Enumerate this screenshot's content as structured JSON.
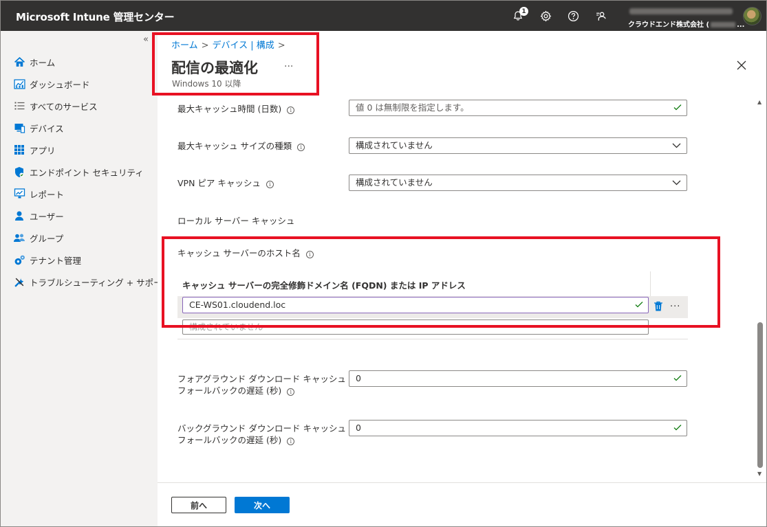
{
  "app": {
    "title": "Microsoft Intune 管理センター"
  },
  "topbar": {
    "notification_count": "1",
    "account_org": "クラウドエンド株式会社 (",
    "account_org_suffix": "..."
  },
  "sidebar": {
    "collapse_glyph": "«",
    "items": [
      {
        "label": "ホーム",
        "icon": "home-icon"
      },
      {
        "label": "ダッシュボード",
        "icon": "dashboard-icon"
      },
      {
        "label": "すべてのサービス",
        "icon": "list-icon"
      },
      {
        "label": "デバイス",
        "icon": "device-icon"
      },
      {
        "label": "アプリ",
        "icon": "apps-grid-icon"
      },
      {
        "label": "エンドポイント セキュリティ",
        "icon": "shield-icon"
      },
      {
        "label": "レポート",
        "icon": "report-icon"
      },
      {
        "label": "ユーザー",
        "icon": "user-icon"
      },
      {
        "label": "グループ",
        "icon": "group-icon"
      },
      {
        "label": "テナント管理",
        "icon": "tenant-gear-icon"
      },
      {
        "label": "トラブルシューティング + サポート",
        "icon": "tools-icon"
      }
    ]
  },
  "header": {
    "breadcrumb": [
      "ホーム",
      "デバイス | 構成"
    ],
    "breadcrumb_sep": ">",
    "title": "配信の最適化",
    "title_more": "...",
    "subtitle": "Windows 10 以降"
  },
  "settings": {
    "max_cache_age": {
      "label": "最大キャッシュ時間 (日数)",
      "value": "値 0 は無制限を指定します。"
    },
    "max_cache_size_type": {
      "label": "最大キャッシュ サイズの種類",
      "value": "構成されていません"
    },
    "vpn_peer_caching": {
      "label": "VPN ピア キャッシュ",
      "value": "構成されていません"
    },
    "local_server_caching": {
      "label": "ローカル サーバー キャッシュ"
    },
    "cache_server_hostname": {
      "label": "キャッシュ サーバーのホスト名",
      "column_header": "キャッシュ サーバーの完全修飾ドメイン名 (FQDN) または IP アドレス",
      "rows": [
        "CE-WS01.cloudend.loc"
      ],
      "new_placeholder": "構成されていません",
      "row_more": "..."
    },
    "foreground_fallback": {
      "label_line1": "フォアグラウンド ダウンロード キャッシュ サーバー",
      "label_line2": "フォールバックの遅延 (秒)",
      "value": "0"
    },
    "background_fallback": {
      "label_line1": "バックグラウンド ダウンロード キャッシュ サーバー",
      "label_line2": "フォールバックの遅延 (秒)",
      "value": "0"
    }
  },
  "footer": {
    "prev_label": "前へ",
    "next_label": "次へ"
  },
  "colors": {
    "topbar": "#323130",
    "accent": "#0078d4",
    "highlight_box": "#e81123",
    "valid_check": "#107c10"
  }
}
